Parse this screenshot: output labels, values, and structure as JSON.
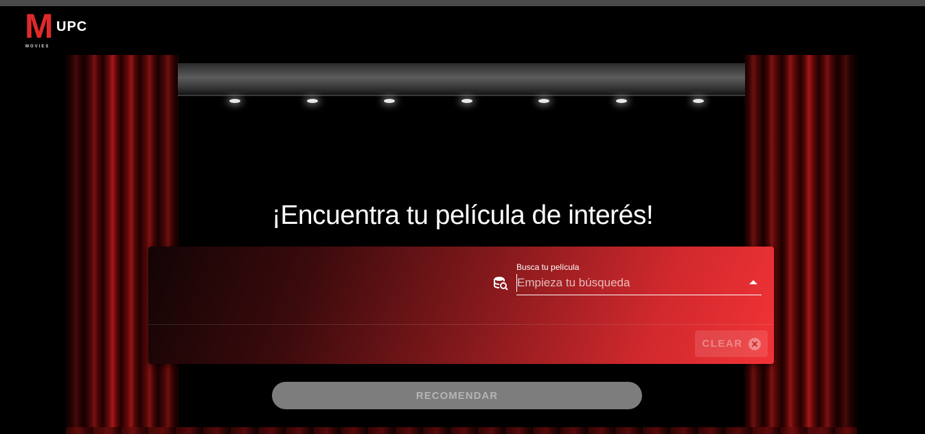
{
  "brand": {
    "logo_letter": "M",
    "logo_name": "UPC",
    "logo_tagline": "MOVIES",
    "accent_color": "#e02a2a"
  },
  "hero": {
    "headline": "¡Encuentra tu película de interés!"
  },
  "search": {
    "label": "Busca tu película",
    "placeholder": "Empieza tu búsqueda",
    "value": "",
    "icon": "database-search-icon",
    "dropdown_icon": "arrow-drop-up-icon"
  },
  "actions": {
    "clear_label": "CLEAR",
    "clear_icon": "close-circle-icon",
    "recommend_label": "RECOMENDAR"
  },
  "colors": {
    "card_gradient_start": "#130405",
    "card_gradient_end": "#f13336",
    "recommend_button": "#7d7d7d"
  }
}
